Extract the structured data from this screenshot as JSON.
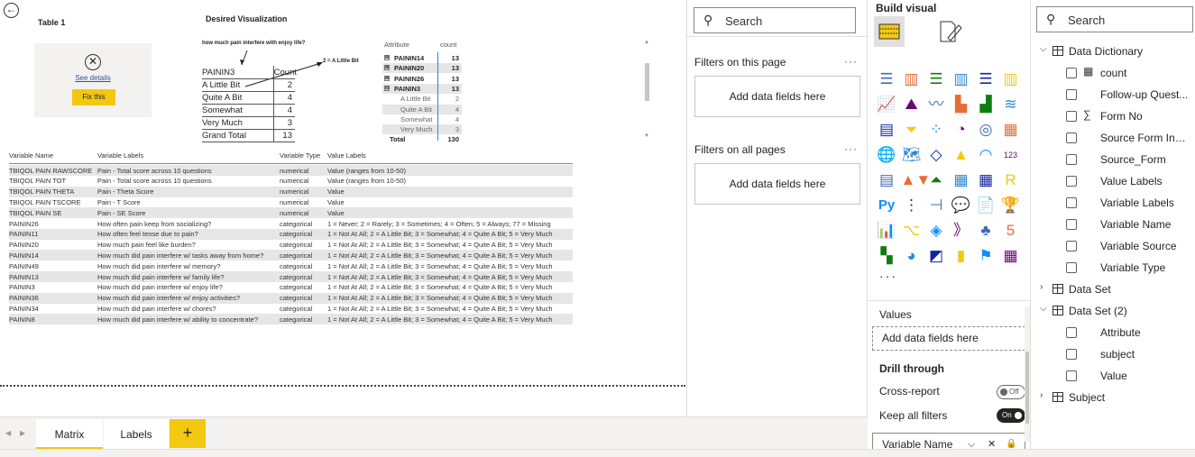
{
  "canvas": {
    "table1_title": "Table 1",
    "error_card": {
      "details_link": "See details",
      "fix_button": "Fix this"
    },
    "desired_title": "Desired Visualization",
    "desired": {
      "question": "how much pain interfere with enjoy life?",
      "annotation": "2 = A Little Bit",
      "header": {
        "label": "PAININ3",
        "value": "Count"
      },
      "rows": [
        {
          "label": "A Little Bit",
          "value": "2"
        },
        {
          "label": "Quite A Bit",
          "value": "4"
        },
        {
          "label": "Somewhat",
          "value": "4"
        },
        {
          "label": "Very Much",
          "value": "3"
        },
        {
          "label": "Grand Total",
          "value": "13"
        }
      ]
    },
    "matrix": {
      "headers": {
        "attribute": "Attribute",
        "count": "count"
      },
      "rows": [
        {
          "attribute": "PAININ14",
          "count": "13",
          "kind": "parent",
          "expand": "⊞"
        },
        {
          "attribute": "PAININ20",
          "count": "13",
          "kind": "parent",
          "expand": "⊞"
        },
        {
          "attribute": "PAININ26",
          "count": "13",
          "kind": "parent",
          "expand": "⊞"
        },
        {
          "attribute": "PAININ3",
          "count": "13",
          "kind": "parent",
          "expand": "⊟"
        },
        {
          "attribute": "A Little Bit",
          "count": "2",
          "kind": "child"
        },
        {
          "attribute": "Quite A Bit",
          "count": "4",
          "kind": "child"
        },
        {
          "attribute": "Somewhat",
          "count": "4",
          "kind": "child"
        },
        {
          "attribute": "Very Much",
          "count": "3",
          "kind": "child"
        },
        {
          "attribute": "Total",
          "count": "130",
          "kind": "total"
        }
      ]
    },
    "table": {
      "headers": [
        "Variable Name",
        "Variable Labels",
        "Variable Type",
        "Value Labels"
      ],
      "rows": [
        [
          "TBIQOL PAIN RAWSCORE",
          "Pain - Total score across 10 questions",
          "numerical",
          "Value (ranges from 10-50)"
        ],
        [
          "TBIQOL PAIN TOT",
          "Pain - Total score across 10 questions",
          "numerical",
          "Value (ranges from 10-50)"
        ],
        [
          "TBIQOL PAIN THETA",
          "Pain - Theta Score",
          "numerical",
          "Value"
        ],
        [
          "TBIQOL PAIN TSCORE",
          "Pain - T Score",
          "numerical",
          "Value"
        ],
        [
          "TBIQOL PAIN SE",
          "Pain - SE Score",
          "numerical",
          "Value"
        ],
        [
          "PAININ26",
          "How often pain keep from socializing?",
          "categorical",
          "1 = Never; 2 = Rarely; 3 = Sometimes; 4 = Often; 5 = Always; 77 = Missing"
        ],
        [
          "PAININ11",
          "How often feel tense due to pain?",
          "categorical",
          "1 = Not At All; 2 = A Little Bit; 3 = Somewhat; 4 = Quite A Bit; 5 = Very Much"
        ],
        [
          "PAININ20",
          "How much pain feel like burden?",
          "categorical",
          "1 = Not At All; 2 = A Little Bit; 3 = Somewhat; 4 = Quite A Bit; 5 = Very Much"
        ],
        [
          "PAININ14",
          "How much did pain interfere w/ tasks away from home?",
          "categorical",
          "1 = Not At All; 2 = A Little Bit; 3 = Somewhat; 4 = Quite A Bit; 5 = Very Much"
        ],
        [
          "PAININ49",
          "How much did pain interfere w/ memory?",
          "categorical",
          "1 = Not At All; 2 = A Little Bit; 3 = Somewhat; 4 = Quite A Bit; 5 = Very Much"
        ],
        [
          "PAININ13",
          "How much did pain interfere w/ family life?",
          "categorical",
          "1 = Not At All; 2 = A Little Bit; 3 = Somewhat; 4 = Quite A Bit; 5 = Very Much"
        ],
        [
          "PAININ3",
          "How much did pain interfere w/ enjoy life?",
          "categorical",
          "1 = Not At All; 2 = A Little Bit; 3 = Somewhat; 4 = Quite A Bit; 5 = Very Much"
        ],
        [
          "PAININ36",
          "How much did pain interfere w/ enjoy activities?",
          "categorical",
          "1 = Not At All; 2 = A Little Bit; 3 = Somewhat; 4 = Quite A Bit; 5 = Very Much"
        ],
        [
          "PAININ34",
          "How much did pain interfere w/ chores?",
          "categorical",
          "1 = Not At All; 2 = A Little Bit; 3 = Somewhat; 4 = Quite A Bit; 5 = Very Much"
        ],
        [
          "PAININ8",
          "How much did pain interfere w/ ability to concentrate?",
          "categorical",
          "1 = Not At All; 2 = A Little Bit; 3 = Somewhat; 4 = Quite A Bit; 5 = Very Much"
        ]
      ]
    }
  },
  "tabs": {
    "items": [
      "Matrix",
      "Labels"
    ],
    "active": "Matrix",
    "add": "+"
  },
  "filters": {
    "search_placeholder": "Search",
    "on_page": "Filters on this page",
    "on_all": "Filters on all pages",
    "add_fields": "Add data fields here",
    "more": "···"
  },
  "viz": {
    "title": "Build visual",
    "more": "···",
    "values_label": "Values",
    "add_fields": "Add data fields here",
    "drill_through": "Drill through",
    "cross_report": "Cross-report",
    "cross_report_state": "Off",
    "keep_all_filters": "Keep all filters",
    "keep_all_state": "On",
    "field_chip": "Variable Name",
    "icons": [
      "stacked-bar-icon",
      "stacked-column-icon",
      "clustered-bar-icon",
      "clustered-column-icon",
      "100-bar-icon",
      "100-column-icon",
      "line-chart-icon",
      "area-chart-icon",
      "stacked-area-icon",
      "line-column-icon",
      "line-clustered-icon",
      "ribbon-chart-icon",
      "waterfall-icon",
      "funnel-icon",
      "scatter-icon",
      "pie-icon",
      "donut-icon",
      "treemap-icon",
      "map-icon",
      "filled-map-icon",
      "shape-map-icon",
      "azure-map-icon",
      "gauge-icon",
      "card-icon",
      "multirow-card-icon",
      "kpi-icon",
      "slicer-icon",
      "table-icon",
      "matrix-icon",
      "r-visual-icon",
      "python-visual-icon",
      "key-influencers-icon",
      "decomp-tree-icon",
      "qa-icon",
      "narrative-icon",
      "trophy-icon",
      "paginated-icon",
      "power-apps-icon",
      "power-automate-icon",
      "chevron-visual-icon",
      "sankey-icon",
      "html5-icon",
      "custom-grid-icon",
      "sunburst-icon",
      "image-visual-icon",
      "bar-chart-icon",
      "flag-icon",
      "table-grid-icon"
    ],
    "glyphs": [
      "☰",
      "▥",
      "☰",
      "▥",
      "☰",
      "▥",
      "📈",
      "⛰",
      "〰",
      "▙",
      "▟",
      "≋",
      "▤",
      "⏷",
      "⁘",
      "◔",
      "◎",
      "▦",
      "🌐",
      "🗺",
      "◇",
      "▲",
      "◠",
      "123",
      "▤",
      "▲▼",
      "⏶",
      "▦",
      "▦",
      "R",
      "Py",
      "⋮",
      "⊣",
      "💬",
      "📄",
      "🏆",
      "📊",
      "⌥",
      "◈",
      "》",
      "♣",
      "5",
      "▚",
      "◕",
      "◩",
      "▮",
      "⚑",
      "▦"
    ]
  },
  "data_pane": {
    "search_placeholder": "Search",
    "items": [
      {
        "type": "table",
        "label": "Data Dictionary",
        "expanded": true
      },
      {
        "type": "field",
        "label": "count",
        "icon": "calc"
      },
      {
        "type": "field",
        "label": "Follow-up Quest..."
      },
      {
        "type": "field",
        "label": "Form No",
        "icon": "sum"
      },
      {
        "type": "field",
        "label": "Source Form Inst..."
      },
      {
        "type": "field",
        "label": "Source_Form"
      },
      {
        "type": "field",
        "label": "Value Labels"
      },
      {
        "type": "field",
        "label": "Variable Labels"
      },
      {
        "type": "field",
        "label": "Variable Name"
      },
      {
        "type": "field",
        "label": "Variable Source"
      },
      {
        "type": "field",
        "label": "Variable Type"
      },
      {
        "type": "table",
        "label": "Data Set",
        "expanded": false
      },
      {
        "type": "table",
        "label": "Data Set (2)",
        "expanded": true
      },
      {
        "type": "field",
        "label": "Attribute"
      },
      {
        "type": "field",
        "label": "subject"
      },
      {
        "type": "field",
        "label": "Value"
      },
      {
        "type": "table",
        "label": "Subject",
        "expanded": false
      }
    ]
  }
}
